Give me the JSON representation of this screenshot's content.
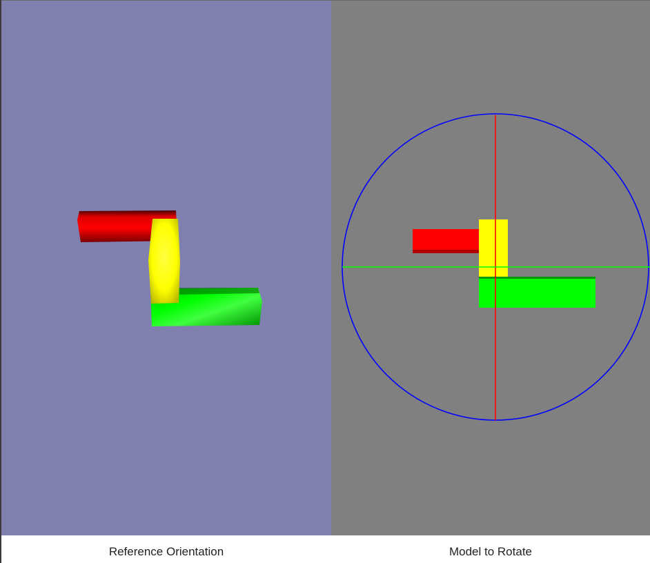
{
  "colors": {
    "reference_background": "#7f7fb0",
    "model_background": "#808080",
    "block_red": "#ff0000",
    "block_yellow": "#ffff00",
    "block_green": "#00ff00",
    "gizmo_circle": "#0000ff",
    "gizmo_vertical_axis": "#ff0000",
    "gizmo_horizontal_axis": "#00ff00"
  },
  "reference_panel": {
    "caption": "Reference Orientation"
  },
  "model_panel": {
    "caption": "Model to Rotate"
  }
}
